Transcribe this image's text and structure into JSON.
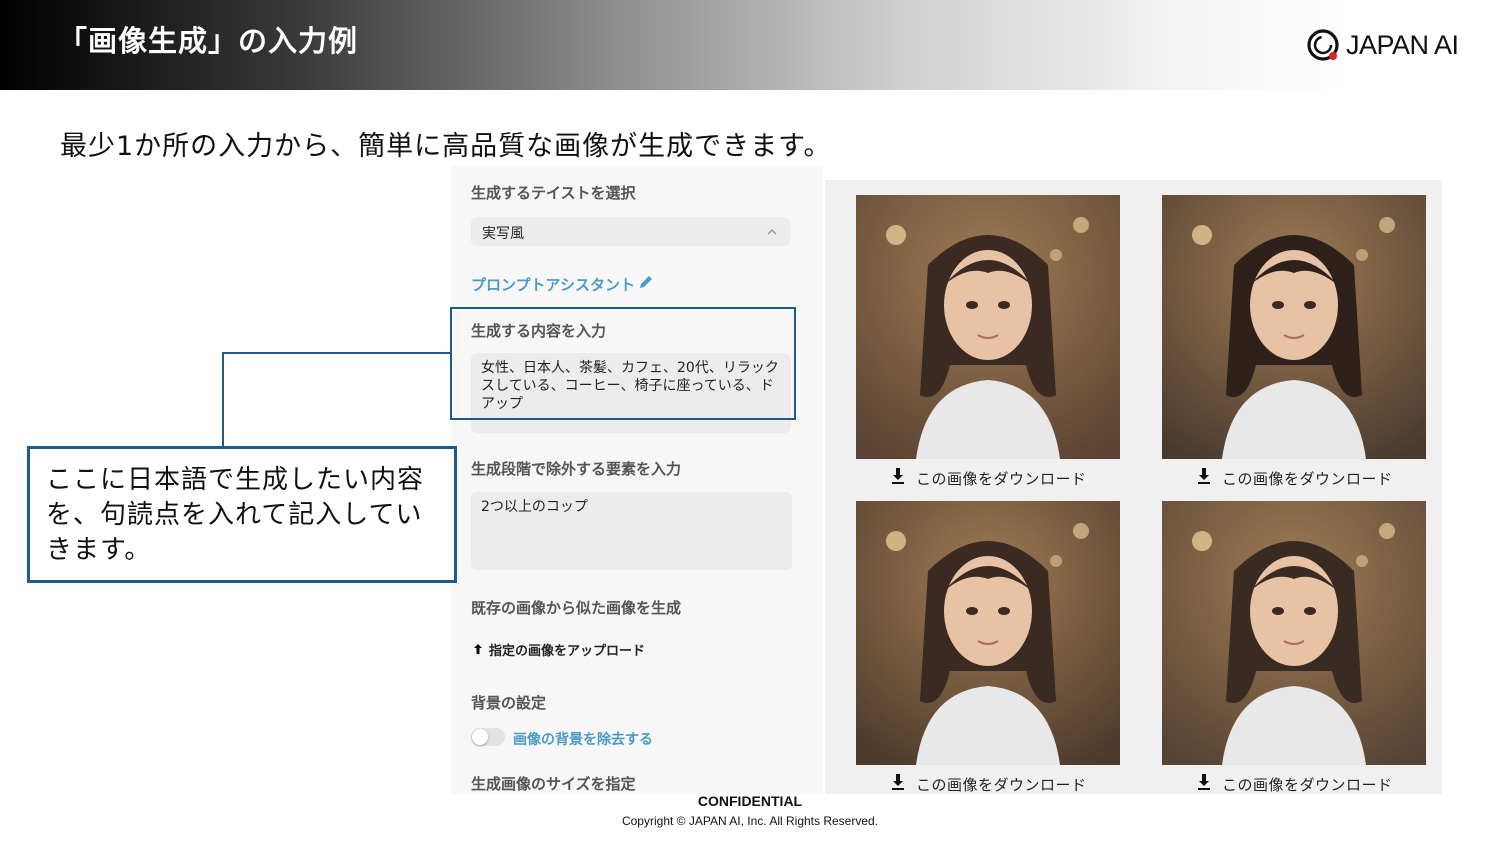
{
  "header": {
    "title": "「画像生成」の入力例",
    "logo_text": "JAPAN AI"
  },
  "subtitle": "最少1か所の入力から、簡単に高品質な画像が生成できます。",
  "form": {
    "taste_label": "生成するテイストを選択",
    "taste_value": "実写風",
    "prompt_assistant": "プロンプトアシスタント",
    "content_label": "生成する内容を入力",
    "content_value": "女性、日本人、茶髪、カフェ、20代、リラックスしている、コーヒー、椅子に座っている、ドアップ",
    "exclude_label": "生成段階で除外する要素を入力",
    "exclude_value": "2つ以上のコップ",
    "similar_label": "既存の画像から似た画像を生成",
    "upload_label": "指定の画像をアップロード",
    "background_label": "背景の設定",
    "remove_bg_label": "画像の背景を除去する",
    "remove_bg_on": false,
    "size_label": "生成画像のサイズを指定"
  },
  "callout": {
    "text": "ここに日本語で生成したい内容を、句読点を入れて記入していきます。"
  },
  "results": {
    "download_label": "この画像をダウンロード",
    "images": [
      {
        "name": "generated-image-1",
        "hair": "#3b2a22",
        "bg": "#5a4332"
      },
      {
        "name": "generated-image-2",
        "hair": "#2e211b",
        "bg": "#4a3a2e"
      },
      {
        "name": "generated-image-3",
        "hair": "#3a2a22",
        "bg": "#4d3a2b"
      },
      {
        "name": "generated-image-4",
        "hair": "#3a2b22",
        "bg": "#564334"
      }
    ]
  },
  "footer": {
    "confidential": "CONFIDENTIAL",
    "copyright": "Copyright © JAPAN AI, Inc. All Rights Reserved."
  },
  "colors": {
    "accent_blue": "#1e5a8c",
    "link_blue": "#4a9cc8",
    "logo_red": "#e0202a"
  }
}
